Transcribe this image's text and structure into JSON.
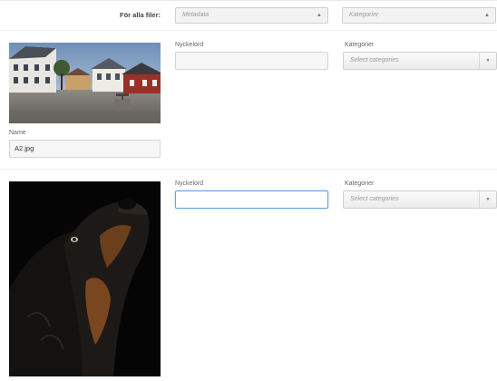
{
  "bulk": {
    "label": "För alla filer:",
    "metadata_placeholder": "Metadata",
    "categories_placeholder": "Kategorier"
  },
  "files": [
    {
      "image_name": "town-street-photo",
      "keywords_label": "Nyckelord",
      "keywords_value": "",
      "categories_label": "Kategorier",
      "categories_placeholder": "Select categories",
      "name_label": "Name",
      "name_value": "A2.jpg"
    },
    {
      "image_name": "dog-portrait-photo",
      "keywords_label": "Nyckelord",
      "keywords_value": "",
      "categories_label": "Kategorier",
      "categories_placeholder": "Select categories"
    }
  ]
}
